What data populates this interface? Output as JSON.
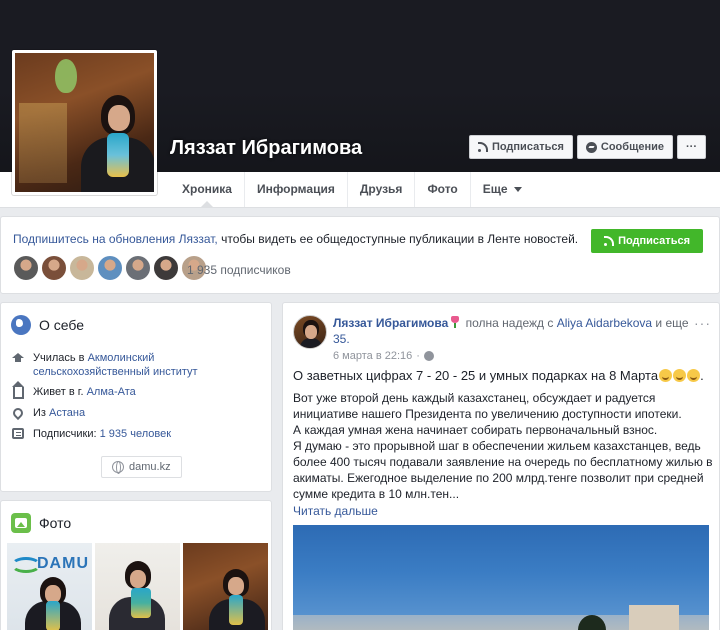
{
  "profile": {
    "name": "Ляззат Ибрагимова"
  },
  "cover_actions": {
    "subscribe": "Подписаться",
    "message": "Сообщение",
    "more": "···"
  },
  "tabs": [
    {
      "label": "Хроника",
      "active": true
    },
    {
      "label": "Информация"
    },
    {
      "label": "Друзья"
    },
    {
      "label": "Фото"
    },
    {
      "label": "Еще"
    }
  ],
  "follow": {
    "text_prefix": "Подпишитесь на обновления Ляззат,",
    "text_suffix": " чтобы видеть ее общедоступные публикации в Ленте новостей.",
    "button": "Подписаться",
    "count": "1 935 подписчиков",
    "avatar_colors": [
      "#5a5a5a",
      "#7a4f3a",
      "#c8b79a",
      "#5e8fbf",
      "#6b6f76",
      "#3d3a3a",
      "#b8a08a"
    ]
  },
  "about": {
    "title": "О себе",
    "studied_prefix": "Училась в ",
    "studied_link": "Акмолинский сельскохозяйственный институт",
    "lives_prefix": "Живет в г. ",
    "lives_link": "Алма-Ата",
    "from_prefix": "Из ",
    "from_link": "Астана",
    "followers_prefix": "Подписчики: ",
    "followers_link": "1 935 человек",
    "website": "damu.kz"
  },
  "photos": {
    "title": "Фото",
    "logo_text": "DAMU"
  },
  "post": {
    "author": "Ляззат Ибрагимова",
    "feeling": " полна надежд с ",
    "with_person": "Aliya Aidarbekova",
    "and_more": " и еще ",
    "more_count": "35.",
    "date": "6 марта в 22:16",
    "menu": "···",
    "lead": "О заветных цифрах 7 - 20 - 25 и умных подарках на 8 Марта",
    "paragraph1": "Вот уже второй день каждый казахстанец, обсуждает и радуется инициативе нашего Президента по увеличению доступности ипотеки.",
    "paragraph2": "А каждая умная жена начинает собирать первоначальный взнос.",
    "paragraph3": "Я думаю - это прорывной шаг в обеспечении жильем казахстанцев, ведь более 400 тысяч подавали заявление на очередь по бесплатному жилью в акиматы. Ежегодное выделение по 200 млрд.тенге позволит при средней сумме кредита в 10 млн.тен...",
    "read_more": "Читать дальше"
  },
  "colors": {
    "link": "#365899",
    "green": "#42b72a",
    "cover": "#1a1b22"
  }
}
